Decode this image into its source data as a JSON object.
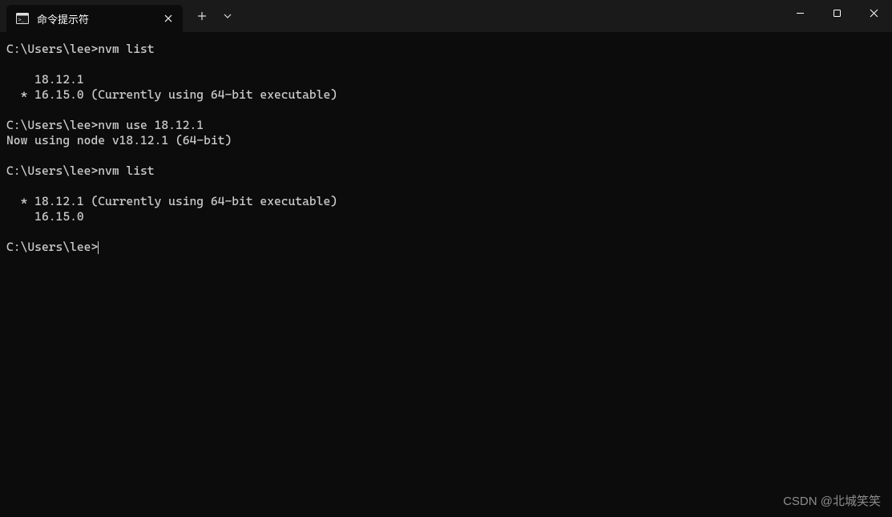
{
  "titlebar": {
    "tab_title": "命令提示符"
  },
  "terminal": {
    "lines": [
      "C:\\Users\\lee>nvm list",
      "",
      "    18.12.1",
      "  * 16.15.0 (Currently using 64-bit executable)",
      "",
      "C:\\Users\\lee>nvm use 18.12.1",
      "Now using node v18.12.1 (64-bit)",
      "",
      "C:\\Users\\lee>nvm list",
      "",
      "  * 18.12.1 (Currently using 64-bit executable)",
      "    16.15.0",
      "",
      "C:\\Users\\lee>"
    ]
  },
  "watermark": "CSDN @北城笑笑"
}
